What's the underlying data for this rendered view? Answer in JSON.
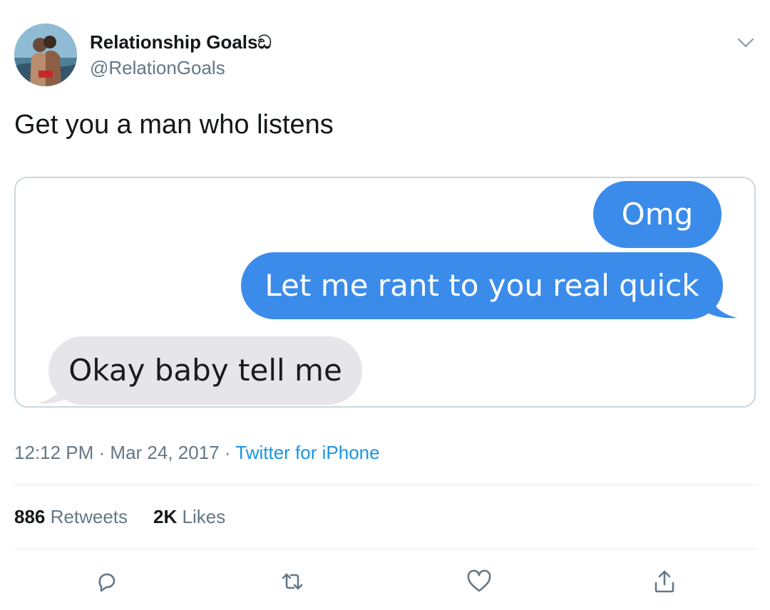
{
  "author": {
    "display_name": "Relationship Goalsඞ",
    "handle": "@RelationGoals",
    "avatar_icon": "avatar-photo"
  },
  "tweet": {
    "text": "Get you a man who listens"
  },
  "media": {
    "messages": [
      {
        "direction": "sent",
        "text": "Omg"
      },
      {
        "direction": "sent",
        "text": "Let me rant to you real quick"
      },
      {
        "direction": "received",
        "text": "Okay baby tell me"
      }
    ],
    "sent_color": "#3b8cea",
    "received_color": "#e5e5ea"
  },
  "meta": {
    "time": "12:12 PM",
    "separator": " · ",
    "date": "Mar 24, 2017",
    "source": "Twitter for iPhone"
  },
  "stats": {
    "retweets_count": "886",
    "retweets_label": "Retweets",
    "likes_count": "2K",
    "likes_label": "Likes"
  },
  "actions": [
    "reply-icon",
    "retweet-icon",
    "like-icon",
    "share-icon"
  ],
  "colors": {
    "text": "#14171a",
    "secondary": "#657786",
    "link": "#1b95e0",
    "border": "#ccd6dd"
  }
}
